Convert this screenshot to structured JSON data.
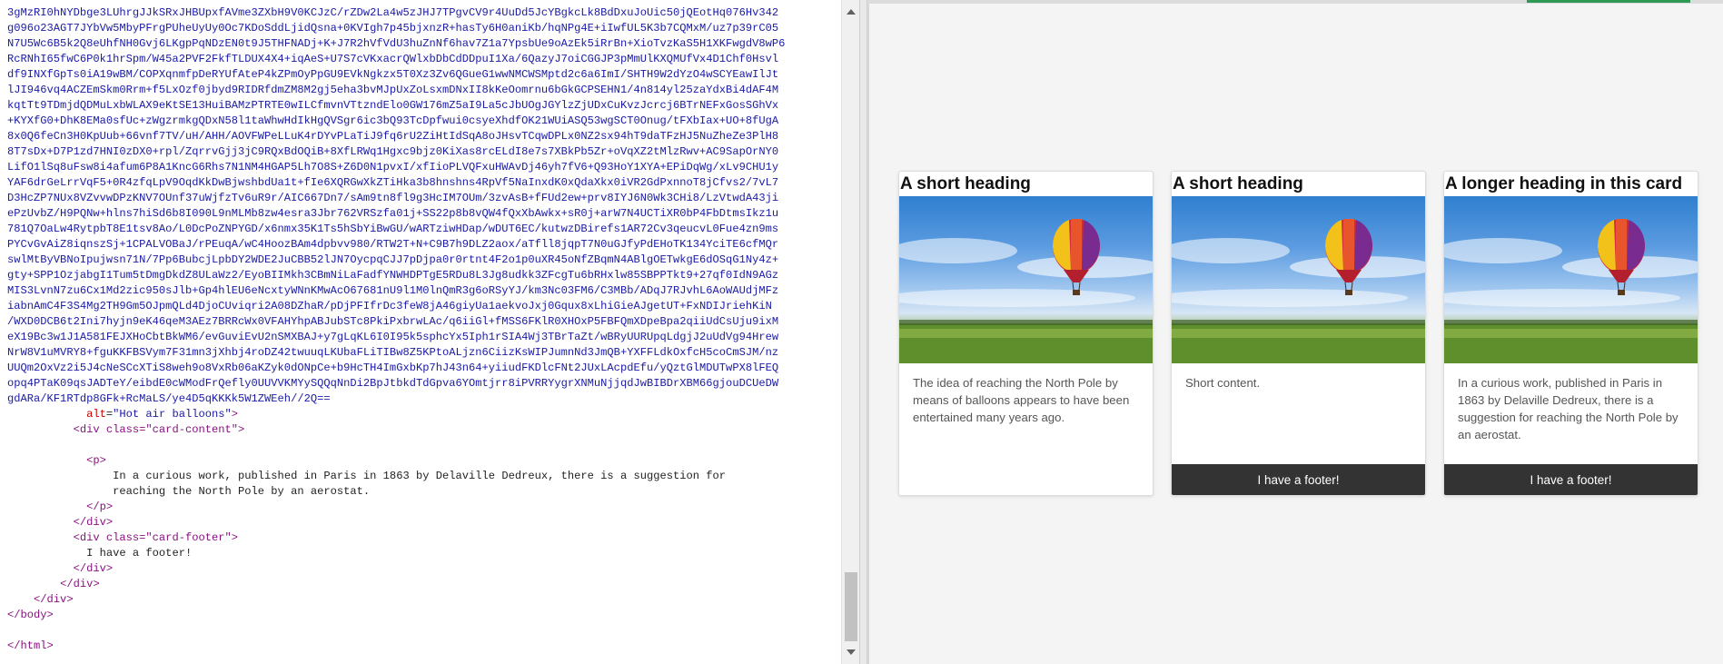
{
  "editor": {
    "base64_lines": [
      "3gMzRI0hNYDbge3LUhrgJJkSRxJHBUpxfAVme3ZXbH9V0KCJzC/rZDw2La4w5zJHJ7TPgvCV9r4UuDd5JcYBgkcLk8BdDxuJoUic50jQEotHq076Hv342",
      "g096o23AGT7JYbVw5MbyPFrgPUheUyUy0Oc7KDoSddLjidQsna+0KVIgh7p45bjxnzR+hasTy6H0aniKb/hqNPg4E+iIwfUL5K3b7CQMxM/uz7p39rC05",
      "N7U5Wc6B5k2Q8eUhfNH0Gvj6LKgpPqNDzEN0t9J5THFNADj+K+J7R2hVfVdU3huZnNf6hav7Z1a7YpsbUe9oAzEk5iRrBn+XioTvzKaS5H1XKFwgdV8wP6",
      "RcRNhI65fwC6P0k1hrSpm/W45a2PVF2FkfTLDUX4X4+iqAeS+U7S7cVKxacrQWlxbDbCdDDpuI1Xa/6QazyJ7oiCGGJP3pMmUlKXQMUfVx4D1Chf0Hsvl",
      "df9INXfGpTs0iA19wBM/COPXqnmfpDeRYUfAteP4kZPmOyPpGU9EVkNgkzx5T0Xz3Zv6QGueG1wwNMCWSMptd2c6a6ImI/SHTH9W2dYzO4wSCYEawIlJt",
      "lJI946vq4ACZEmSkm0Rrm+f5LxOzf0jbyd9RIDRfdmZM8M2gj5eha3bvMJpUxZoLsxmDNxII8kKeOomrnu6bGkGCPSEHN1/4n814yl25zaYdxBi4dAF4M",
      "kqtTt9TDmjdQDMuLxbWLAX9eKtSE13HuiBAMzPTRTE0wILCfmvnVTtzndElo0GW176mZ5aI9La5cJbUOgJGYlzZjUDxCuKvzJcrcj6BTrNEFxGosSGhVx",
      "+KYXfG0+DhK8EMa0sfUc+zWgzrmkgQDxN58l1taWhwHdIkHgQVSgr6ic3bQ93TcDpfwui0csyeXhdfOK21WUiASQ53wgSCT0Onug/tFXbIax+UO+8fUgA",
      "8x0Q6feCn3H0KpUub+66vnf7TV/uH/AHH/AOVFWPeLLuK4rDYvPLaTiJ9fq6rU2ZiHtIdSqA8oJHsvTCqwDPLx0NZ2sx94hT9daTFzHJ5NuZheZe3PlH8",
      "8T7sDx+D7P1zd7HNI0zDX0+rpl/ZqrrvGjj3jC9RQxBdOQiB+8XfLRWq1Hgxc9bjz0KiXas8rcELdI8e7s7XBkPb5Zr+oVqXZ2tMlzRwv+AC9SapOrNY0",
      "LifO1lSq8uFsw8i4afum6P8A1KncG6Rhs7N1NM4HGAP5Lh7O8S+Z6D0N1pvxI/xfIioPLVQFxuHWAvDj46yh7fV6+Q93HoY1XYA+EPiDqWg/xLv9CHU1y",
      "YAF6drGeLrrVqF5+0R4zfqLpV9OqdKkDwBjwshbdUa1t+fIe6XQRGwXkZTiHka3b8hnshns4RpVf5NaInxdK0xQdaXkx0iVR2GdPxnnoT8jCfvs2/7vL7",
      "D3HcZP7NUx8VZvvwDPzKNV7OUnf37uWjfzTv6uR9r/AIC667Dn7/sAm9tn8fl9g3HcIM7OUm/3zvAsB+fFUd2ew+prv8IYJ6N0Wk3CHi8/LzVtwdA43ji",
      "ePzUvbZ/H9PQNw+hlns7hiSd6b8I090L9nMLMb8zw4esra3Jbr762VRSzfa01j+SS22p8b8vQW4fQxXbAwkx+sR0j+arW7N4UCTiXR0bP4FbDtmsIkz1u",
      "781Q7OaLw4RytpbT8E1tsv8Ao/L0DcPoZNPYGD/x6nmx35K1Ts5hSbYiBwGU/wARTziwHDap/wDUT6EC/kutwzDBirefs1AR72Cv3qeucvL0Fue4zn9ms",
      "PYCvGvAiZ8iqnszSj+1CPALVOBaJ/rPEuqA/wC4HoozBAm4dpbvv980/RTW2T+N+C9B7h9DLZ2aox/aTfll8jqpT7N0uGJfyPdEHoTK134YciTE6cfMQr",
      "swlMtByVBNoIpujwsn71N/7Pp6BubcjLpbDY2WDE2JuCBB52lJN7OycpqCJJ7pDjpa0r0rtnt4F2o1p0uXR45oNfZBqmN4ABlgOETwkgE6dOSqG1Ny4z+",
      "gty+SPP1OzjabgI1Tum5tDmgDkdZ8ULaWz2/EyoBIIMkh3CBmNiLaFadfYNWHDPTgE5RDu8L3Jg8udkk3ZFcgTu6bRHxlw85SBPPTkt9+27qf0IdN9AGz",
      "MIS3LvnN7zu6Cx1Md2zic950sJlb+Gp4hlEU6eNcxtyWNnKMwAcO67681nU9l1M0lnQmR3g6oRSyYJ/km3Nc03FM6/C3MBb/ADqJ7RJvhL6AoWAUdjMFz",
      "iabnAmC4F3S4Mg2TH9Gm5OJpmQLd4DjoCUviqri2A08DZhaR/pDjPFIfrDc3feW8jA46giyUa1aekvoJxj0Gqux8xLhiGieAJgetUT+FxNDIJriehKiN",
      "/WXD0DCB6t2Ini7hyjn9eK46qeM3AEz7BRRcWx0VFAHYhpABJubSTc8PkiPxbrwLAc/q6iiGl+fMSS6FKlR0XHOxP5FBFQmXDpeBpa2qiiUdCsUju9ixM",
      "eX19Bc3w1J1A581FEJXHoCbtBkWM6/evGuviEvU2nSMXBAJ+y7gLqKL6I0I95k5sphcYx5Iph1rSIA4Wj3TBrTaZt/wBRyUURUpqLdgjJ2uUdVg94Hrew",
      "NrW8V1uMVRY8+fguKKFBSVym7F31mn3jXhbj4roDZ42twuuqLKUbaFLiTIBw8Z5KPtoALjzn6CiizKsWIPJumnNd3JmQB+YXFFLdkOxfcH5coCmSJM/nz",
      "UUQm2OxVz2i5J4cNeSCcXTiS8weh9o8VxRb06aKZyk0dONpCe+b9HcTH4ImGxbKp7hJ43n64+yiiudFKDlcFNt2JUxLAcpdEfu/yQztGlMDUTwPX8lFEQ",
      "opq4PTaK09qsJADTeY/eibdE0cWModFrQefly0UUVVKMYySQQqNnDi2BpJtbkdTdGpva6YOmtjrr8iPVRRYygrXNMuNjjqdJwBIBDrXBM66gjouDCUeDW",
      "gdARa/KF1RTdp8GFk+RcMaLS/ye4D5qKKKk5W1ZWEeh//2Q=="
    ],
    "alt_attr": "alt",
    "alt_value": "\"Hot air balloons\"",
    "div_open_card_content": "<div class=\"card-content\">",
    "p_open": "<p>",
    "p_text_line1": "In a curious work, published in Paris in 1863 by Delaville Dedreux, there is a suggestion for",
    "p_text_line2": "reaching the North Pole by an aerostat.",
    "p_close": "</p>",
    "div_close": "</div>",
    "div_open_card_footer": "<div class=\"card-footer\">",
    "footer_text": "I have a footer!",
    "body_close": "</body>",
    "html_close": "</html>"
  },
  "preview": {
    "cards": [
      {
        "heading": "A short heading",
        "image_alt": "Hot air balloons",
        "text": "The idea of reaching the North Pole by means of balloons appears to have been entertained many years ago.",
        "footer": ""
      },
      {
        "heading": "A short heading",
        "image_alt": "Hot air balloons",
        "text": "Short content.",
        "footer": "I have a footer!"
      },
      {
        "heading": "A longer heading in this card",
        "image_alt": "Hot air balloons",
        "text": "In a curious work, published in Paris in 1863 by Delaville Dedreux, there is a suggestion for reaching the North Pole by an aerostat.",
        "footer": "I have a footer!"
      }
    ]
  },
  "colors": {
    "footer_bg": "#333333",
    "code_value": "#1a1aa6",
    "code_tag": "#881280",
    "code_attr": "#c80000",
    "accent_green": "#2e9a55"
  }
}
